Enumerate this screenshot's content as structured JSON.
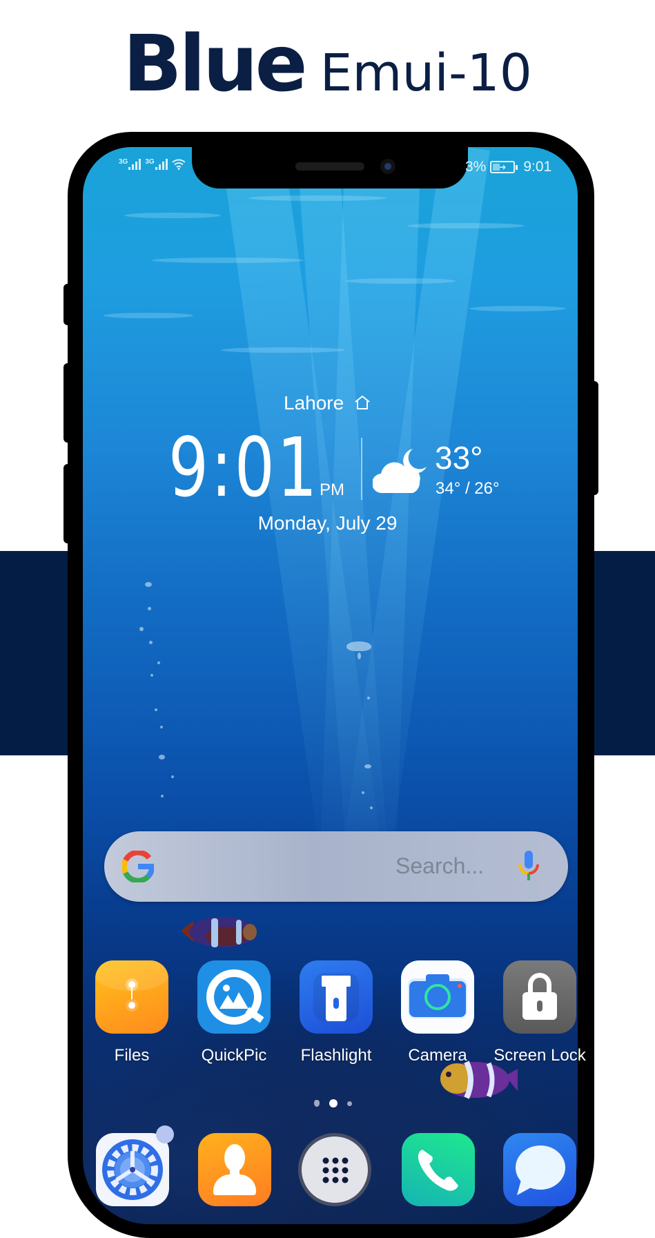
{
  "promo": {
    "title_bold": "Blue",
    "title_light": "Emui-10",
    "accent_color": "#0b1f45",
    "band_color": "#031d44"
  },
  "status_bar": {
    "sim1_network": "3G",
    "sim2_network": "3G",
    "battery_percent_text": "3%",
    "battery_charging": true,
    "time": "9:01"
  },
  "clock_widget": {
    "location": "Lahore",
    "location_icon": "home-icon",
    "time_hour": "9",
    "time_separator": ":",
    "time_minutes": "01",
    "ampm": "PM",
    "weather_icon": "cloud-moon-icon",
    "temperature": "33°",
    "temp_range": "34° / 26°",
    "date": "Monday, July 29"
  },
  "search_bar": {
    "placeholder": "Search...",
    "left_icon": "google-g-icon",
    "right_icon": "microphone-icon"
  },
  "apps": [
    {
      "label": "Files",
      "icon": "files-icon",
      "color": "#ffa21f"
    },
    {
      "label": "QuickPic",
      "icon": "quickpic-icon",
      "color": "#1f8fe6"
    },
    {
      "label": "Flashlight",
      "icon": "flashlight-icon",
      "color": "#2465e6"
    },
    {
      "label": "Camera",
      "icon": "camera-icon",
      "color": "#ffffff"
    },
    {
      "label": "Screen Lock",
      "icon": "lock-icon",
      "color": "#6b6b6b"
    }
  ],
  "page_indicator": {
    "total": 3,
    "current": 2
  },
  "dock": [
    {
      "name": "Settings",
      "icon": "settings-gear-icon",
      "has_badge": true
    },
    {
      "name": "Contacts",
      "icon": "contacts-icon"
    },
    {
      "name": "App Drawer",
      "icon": "app-drawer-icon"
    },
    {
      "name": "Phone",
      "icon": "phone-icon"
    },
    {
      "name": "Messages",
      "icon": "messages-icon"
    }
  ]
}
